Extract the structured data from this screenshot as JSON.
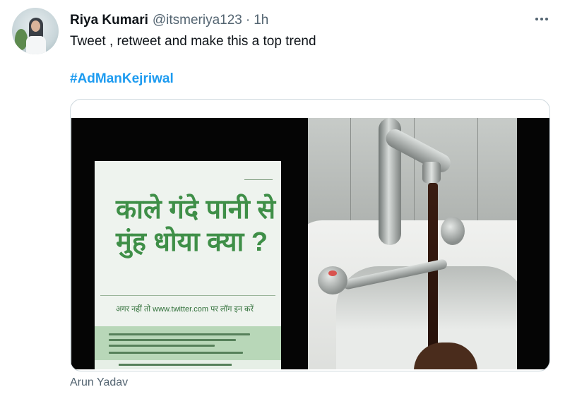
{
  "tweet": {
    "author_name": "Riya Kumari",
    "author_handle": "@itsmeriya123",
    "separator": "·",
    "time": "1h",
    "text": "Tweet , retweet and make this a top trend",
    "hashtag": "#AdManKejriwal"
  },
  "media": {
    "poster_headline": "काले गंदे पानी से मुंह धोया क्या ?",
    "poster_subtext": "अगर नहीं तो www.twitter.com पर लॉग इन करें",
    "caption": "Arun Yadav"
  },
  "icons": {
    "more": "more-horizontal-icon"
  },
  "colors": {
    "link": "#1d9bf0",
    "secondary_text": "#536471",
    "border": "#cfd9de",
    "poster_green": "#3f8f48"
  }
}
